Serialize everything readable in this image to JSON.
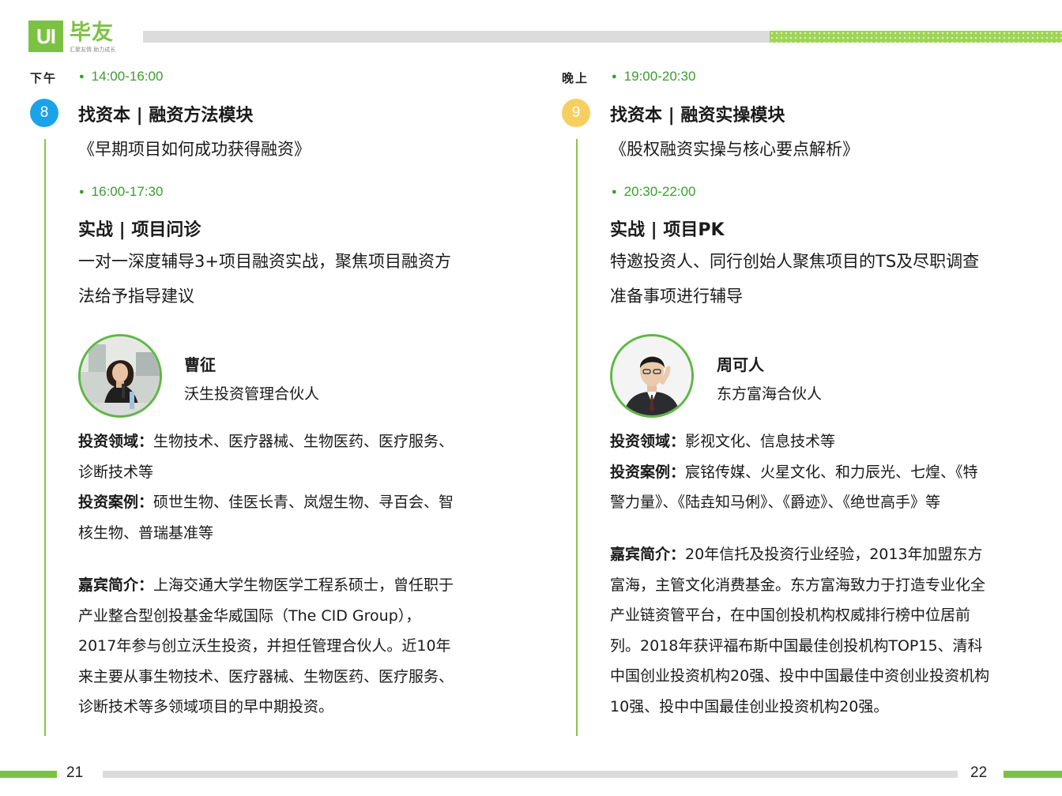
{
  "header": {
    "logo_mark": "UI",
    "logo_name": "毕友",
    "logo_tagline": "汇聚友情 助力成长"
  },
  "footer": {
    "page_left": "21",
    "page_right": "22"
  },
  "colors": {
    "brand_green": "#7cc242",
    "time_green": "#3a9d2e",
    "badge_blue": "#1aa3e8",
    "badge_yellow": "#f7cf60"
  },
  "left": {
    "period": "下午",
    "badge": "8",
    "session1": {
      "time": "14:00-16:00",
      "module": "找资本 | 融资方法模块",
      "topic": "《早期项目如何成功获得融资》"
    },
    "session2": {
      "time": "16:00-17:30",
      "module": "实战 | 项目问诊",
      "desc1": "一对一深度辅导3+项目融资实战，聚焦项目融资方",
      "desc2": "法给予指导建议"
    },
    "speaker": {
      "photo_icon": "female-speaker-photo",
      "name": "曹征",
      "title": "沃生投资管理合伙人"
    },
    "field_label": "投资领域：",
    "field_text1": "生物技术、医疗器械、生物医药、医疗服务、",
    "field_text2": "诊断技术等",
    "case_label": "投资案例：",
    "case_text1": "硕世生物、佳医长青、岚煜生物、寻百会、智",
    "case_text2": "核生物、普瑞基准等",
    "bio_label": "嘉宾简介：",
    "bio1": "上海交通大学生物医学工程系硕士，曾任职于",
    "bio2": "产业整合型创投基金华威国际（The CID Group），",
    "bio3": "2017年参与创立沃生投资，并担任管理合伙人。近10年",
    "bio4": "来主要从事生物技术、医疗器械、生物医药、医疗服务、",
    "bio5": "诊断技术等多领域项目的早中期投资。"
  },
  "right": {
    "period": "晚上",
    "badge": "9",
    "session1": {
      "time": "19:00-20:30",
      "module": "找资本 | 融资实操模块",
      "topic": "《股权融资实操与核心要点解析》"
    },
    "session2": {
      "time": "20:30-22:00",
      "module": "实战 | 项目PK",
      "desc1": "特邀投资人、同行创始人聚焦项目的TS及尽职调查",
      "desc2": "准备事项进行辅导"
    },
    "speaker": {
      "photo_icon": "male-speaker-photo",
      "name": "周可人",
      "title": "东方富海合伙人"
    },
    "field_label": "投资领域：",
    "field_text1": "影视文化、信息技术等",
    "case_label": "投资案例：",
    "case_text1": "宸铭传媒、火星文化、和力辰光、七煌、《特",
    "case_text2": "警力量》、《陆垚知马俐》、《爵迹》、《绝世高手》等",
    "bio_label": "嘉宾简介：",
    "bio1": "20年信托及投资行业经验，2013年加盟东方",
    "bio2": "富海，主管文化消费基金。东方富海致力于打造专业化全",
    "bio3": "产业链资管平台，在中国创投机构权威排行榜中位居前",
    "bio4": "列。2018年获评福布斯中国最佳创投机构TOP15、清科",
    "bio5": "中国创业投资机构20强、投中中国最佳中资创业投资机构",
    "bio6": "10强、投中中国最佳创业投资机构20强。"
  }
}
